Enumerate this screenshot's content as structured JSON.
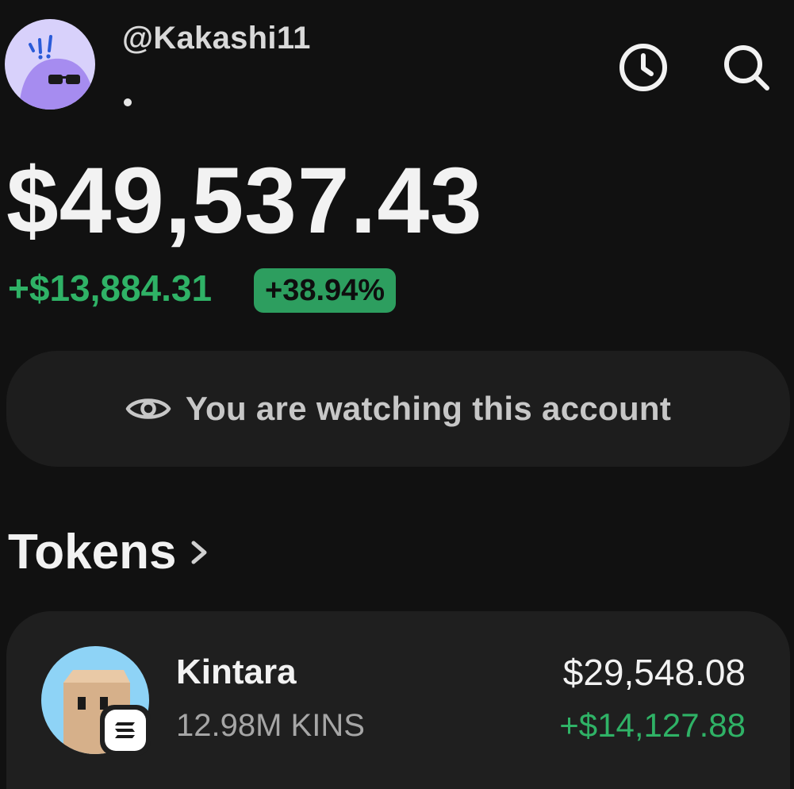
{
  "profile": {
    "username": "@Kakashi11",
    "status_dot": "•"
  },
  "header_icons": {
    "history": "clock-icon",
    "search": "search-icon"
  },
  "balance": {
    "total": "$49,537.43",
    "change_amount": "+$13,884.31",
    "change_percent": "+38.94%"
  },
  "watch_banner": {
    "icon": "eye-icon",
    "text": "You are watching this account"
  },
  "tokens": {
    "section_title": "Tokens",
    "items": [
      {
        "name": "Kintara",
        "amount": "12.98M KINS",
        "value": "$29,548.08",
        "change": "+$14,127.88"
      }
    ]
  },
  "colors": {
    "background": "#111111",
    "card": "#1f1f1f",
    "positive": "#2fb266",
    "positive_pill": "#2d9e5f",
    "avatar_bg": "#d8d1fb",
    "token_logo_bg": "#8ed3f6"
  }
}
